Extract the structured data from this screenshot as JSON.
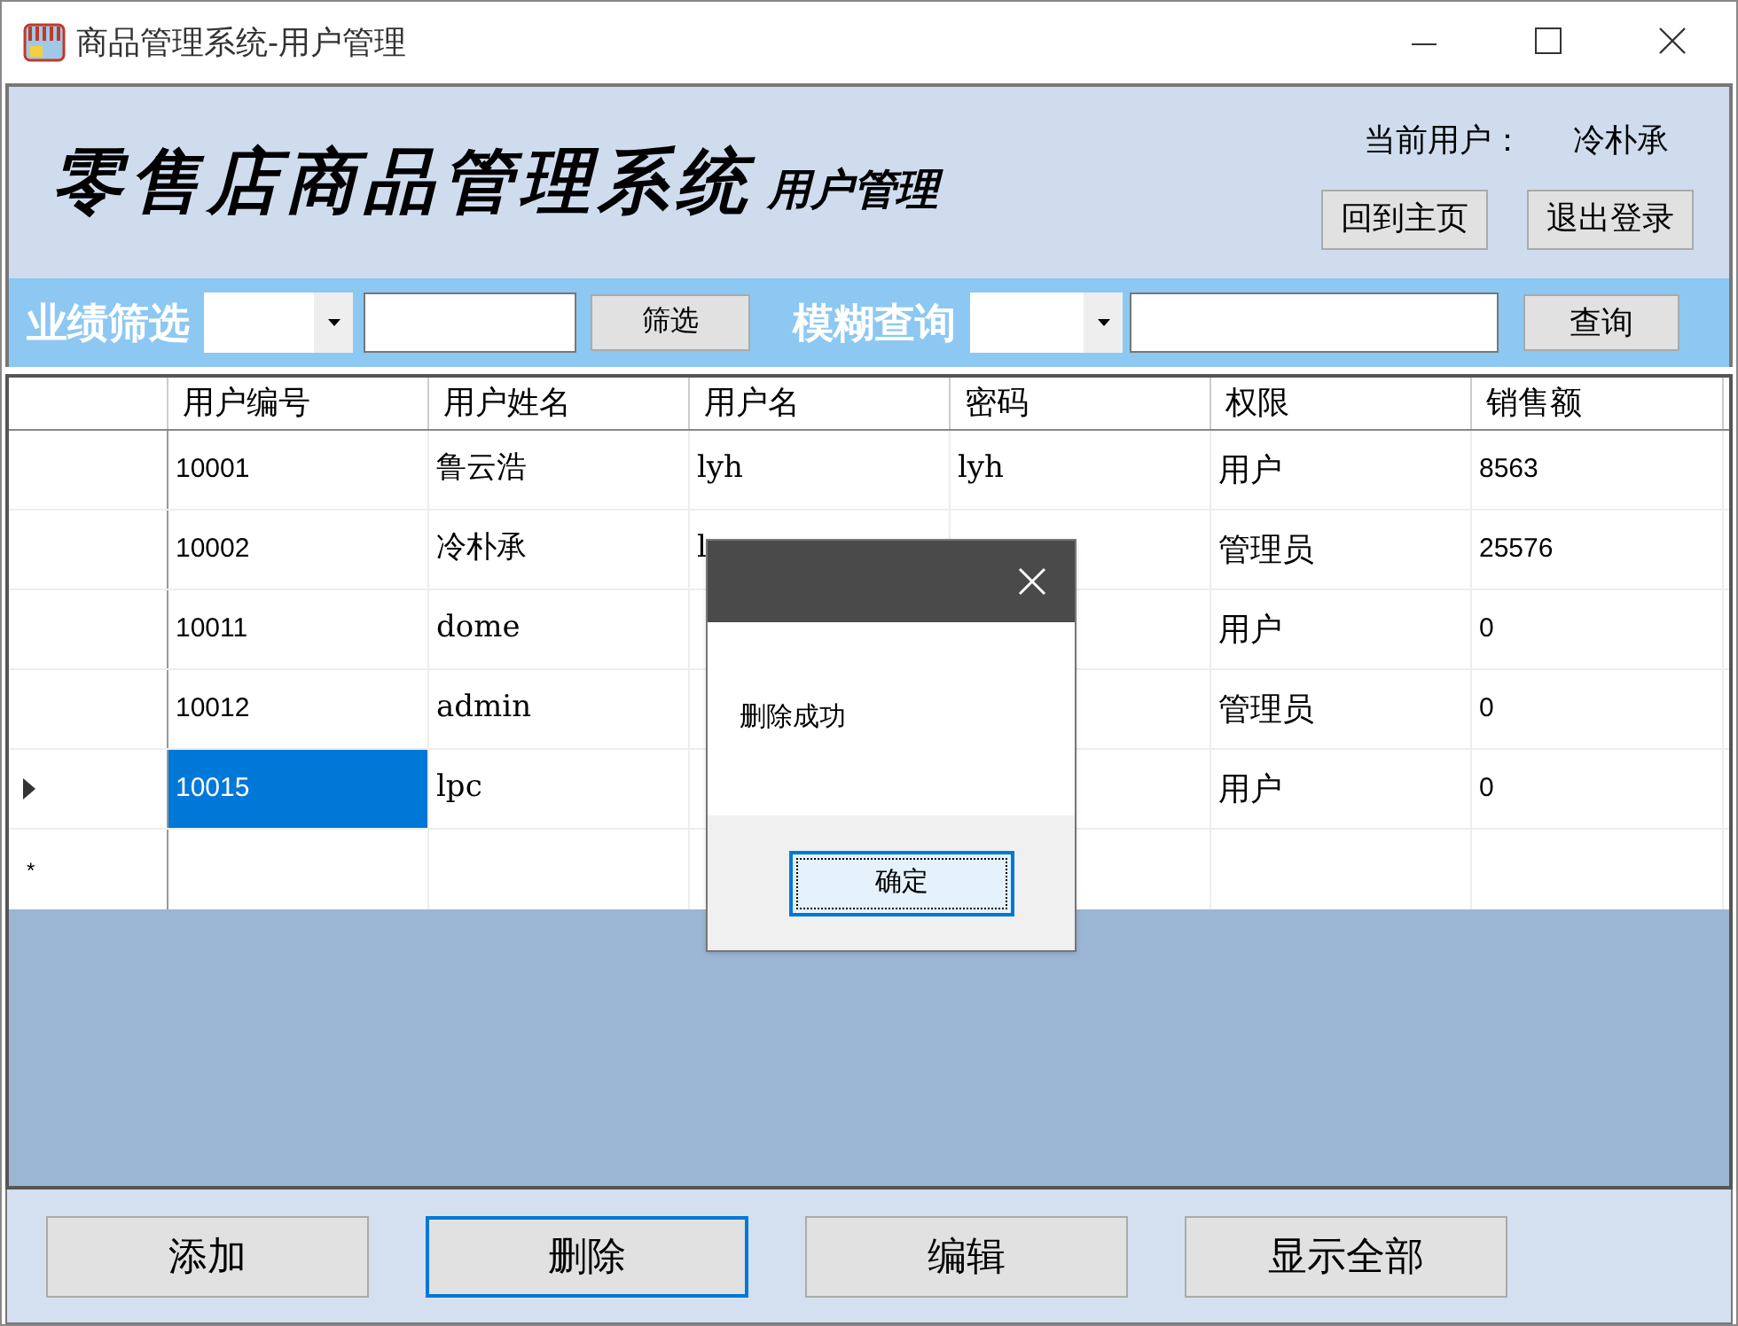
{
  "window": {
    "title": "商品管理系统-用户管理"
  },
  "header": {
    "title": "零售店商品管理系统",
    "subtitle": "用户管理",
    "current_user_label": "当前用户：",
    "current_user": "冷朴承",
    "buttons": [
      "回到主页",
      "退出登录"
    ]
  },
  "filter_bar": {
    "filter_label": "业绩筛选",
    "filter_button": "筛选",
    "search_label": "模糊查询",
    "search_button": "查询"
  },
  "table": {
    "columns": [
      "用户编号",
      "用户姓名",
      "用户名",
      "密码",
      "权限",
      "销售额"
    ],
    "rows": [
      {
        "selected": false,
        "cells": {
          "user_id": "10001",
          "full_name": "鲁云浩",
          "username": "lyh",
          "password": "lyh",
          "role": "用户",
          "sales": "8563"
        }
      },
      {
        "selected": false,
        "cells": {
          "user_id": "10002",
          "full_name": "冷朴承",
          "username": "l",
          "role": "管理员",
          "sales": "25576"
        }
      },
      {
        "selected": false,
        "cells": {
          "user_id": "10011",
          "full_name": "dome",
          "role": "用户",
          "sales": "0"
        }
      },
      {
        "selected": false,
        "cells": {
          "user_id": "10012",
          "full_name": "admin",
          "role": "管理员",
          "sales": "0"
        }
      },
      {
        "selected": true,
        "cells": {
          "user_id": "10015",
          "full_name": "lpc",
          "role": "用户",
          "sales": "0"
        }
      }
    ],
    "new_row_marker": "*"
  },
  "dialog": {
    "message": "删除成功",
    "button": "确定"
  },
  "bottom_buttons": [
    {
      "label": "添加",
      "focused": false
    },
    {
      "label": "删除",
      "focused": true
    },
    {
      "label": "编辑",
      "focused": false
    },
    {
      "label": "显示全部",
      "focused": false
    }
  ]
}
